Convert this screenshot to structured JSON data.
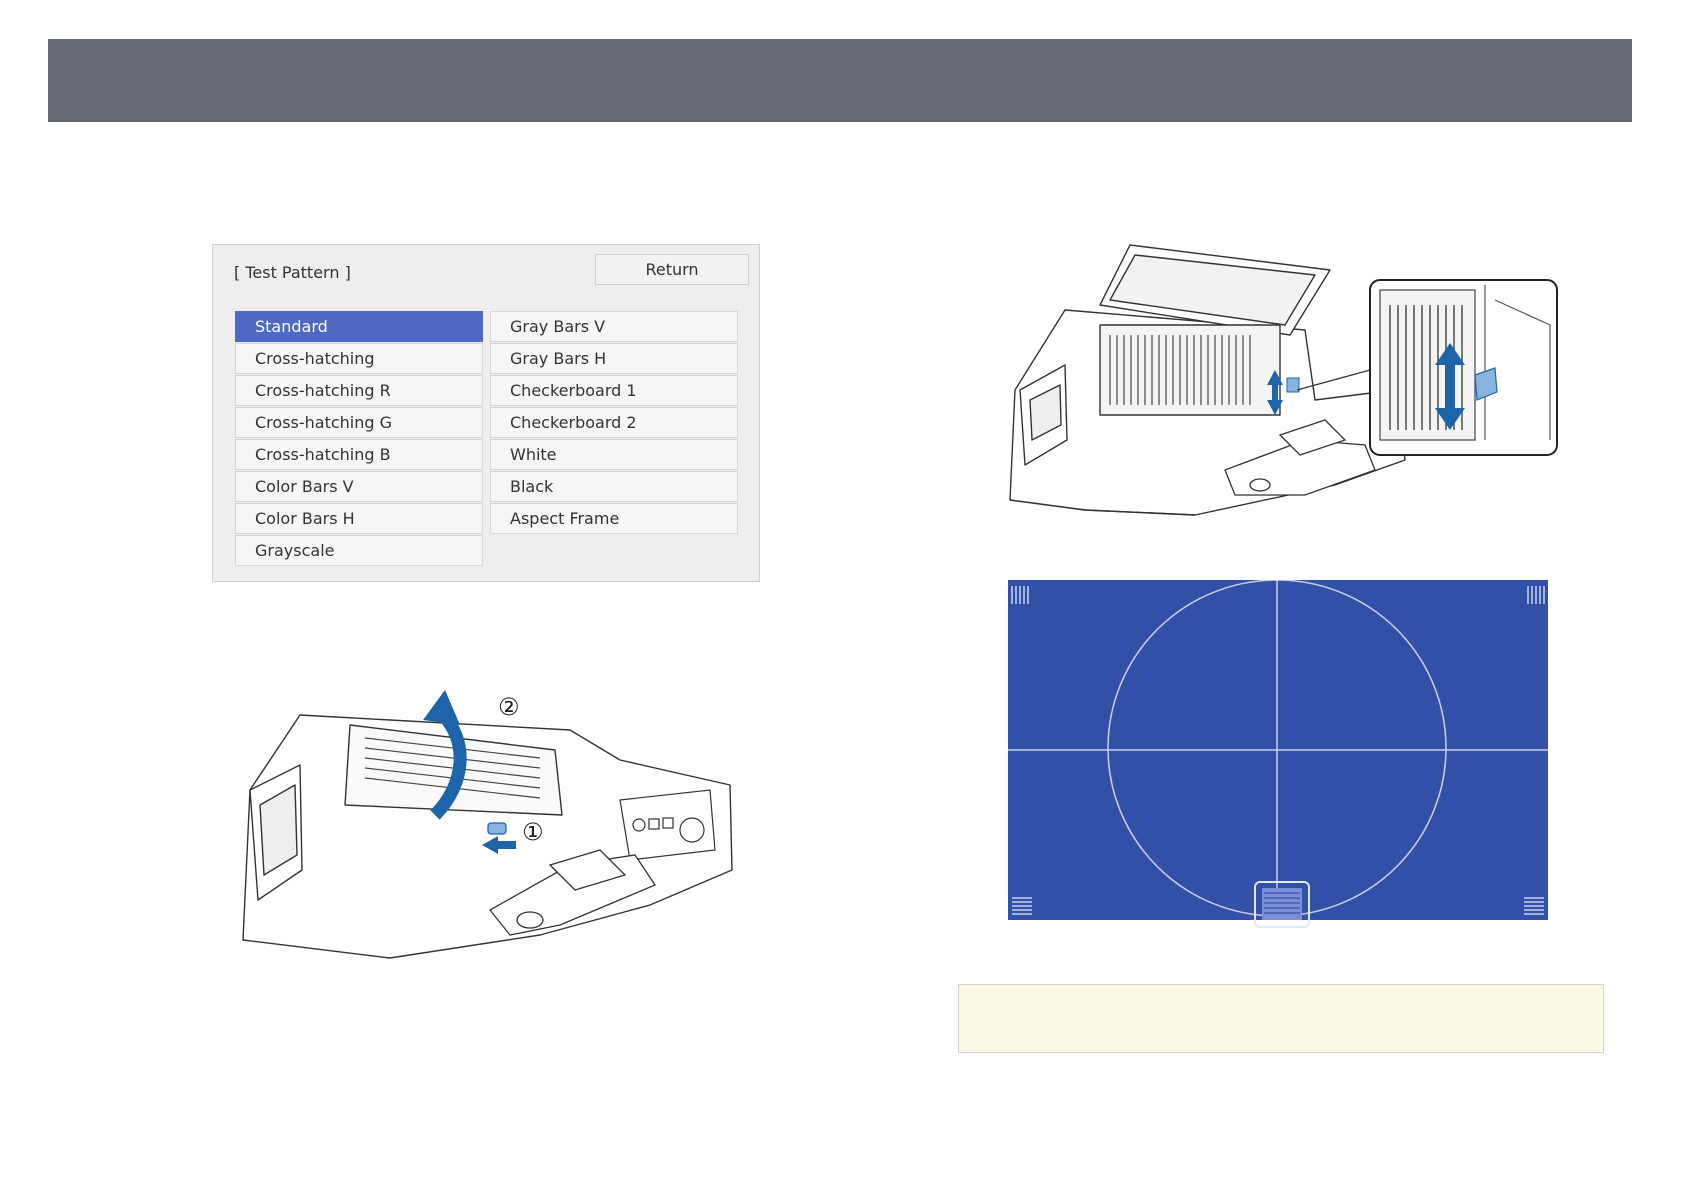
{
  "colors": {
    "header": "#676a72",
    "selected_item": "#4d69c4",
    "pattern_background": "#3350a8",
    "arrow": "#1f64a8",
    "note_background": "#fdf9e9"
  },
  "test_pattern_menu": {
    "title": "[ Test Pattern ]",
    "return_label": "Return",
    "selected": "Standard",
    "left_items": [
      "Standard",
      "Cross-hatching",
      "Cross-hatching R",
      "Cross-hatching G",
      "Cross-hatching B",
      "Color Bars V",
      "Color Bars H",
      "Grayscale"
    ],
    "right_items": [
      "Gray Bars V",
      "Gray Bars H",
      "Checkerboard 1",
      "Checkerboard 2",
      "White",
      "Black",
      "Aspect Frame"
    ]
  },
  "cover_illustration": {
    "step_1": "①",
    "step_2": "②"
  }
}
